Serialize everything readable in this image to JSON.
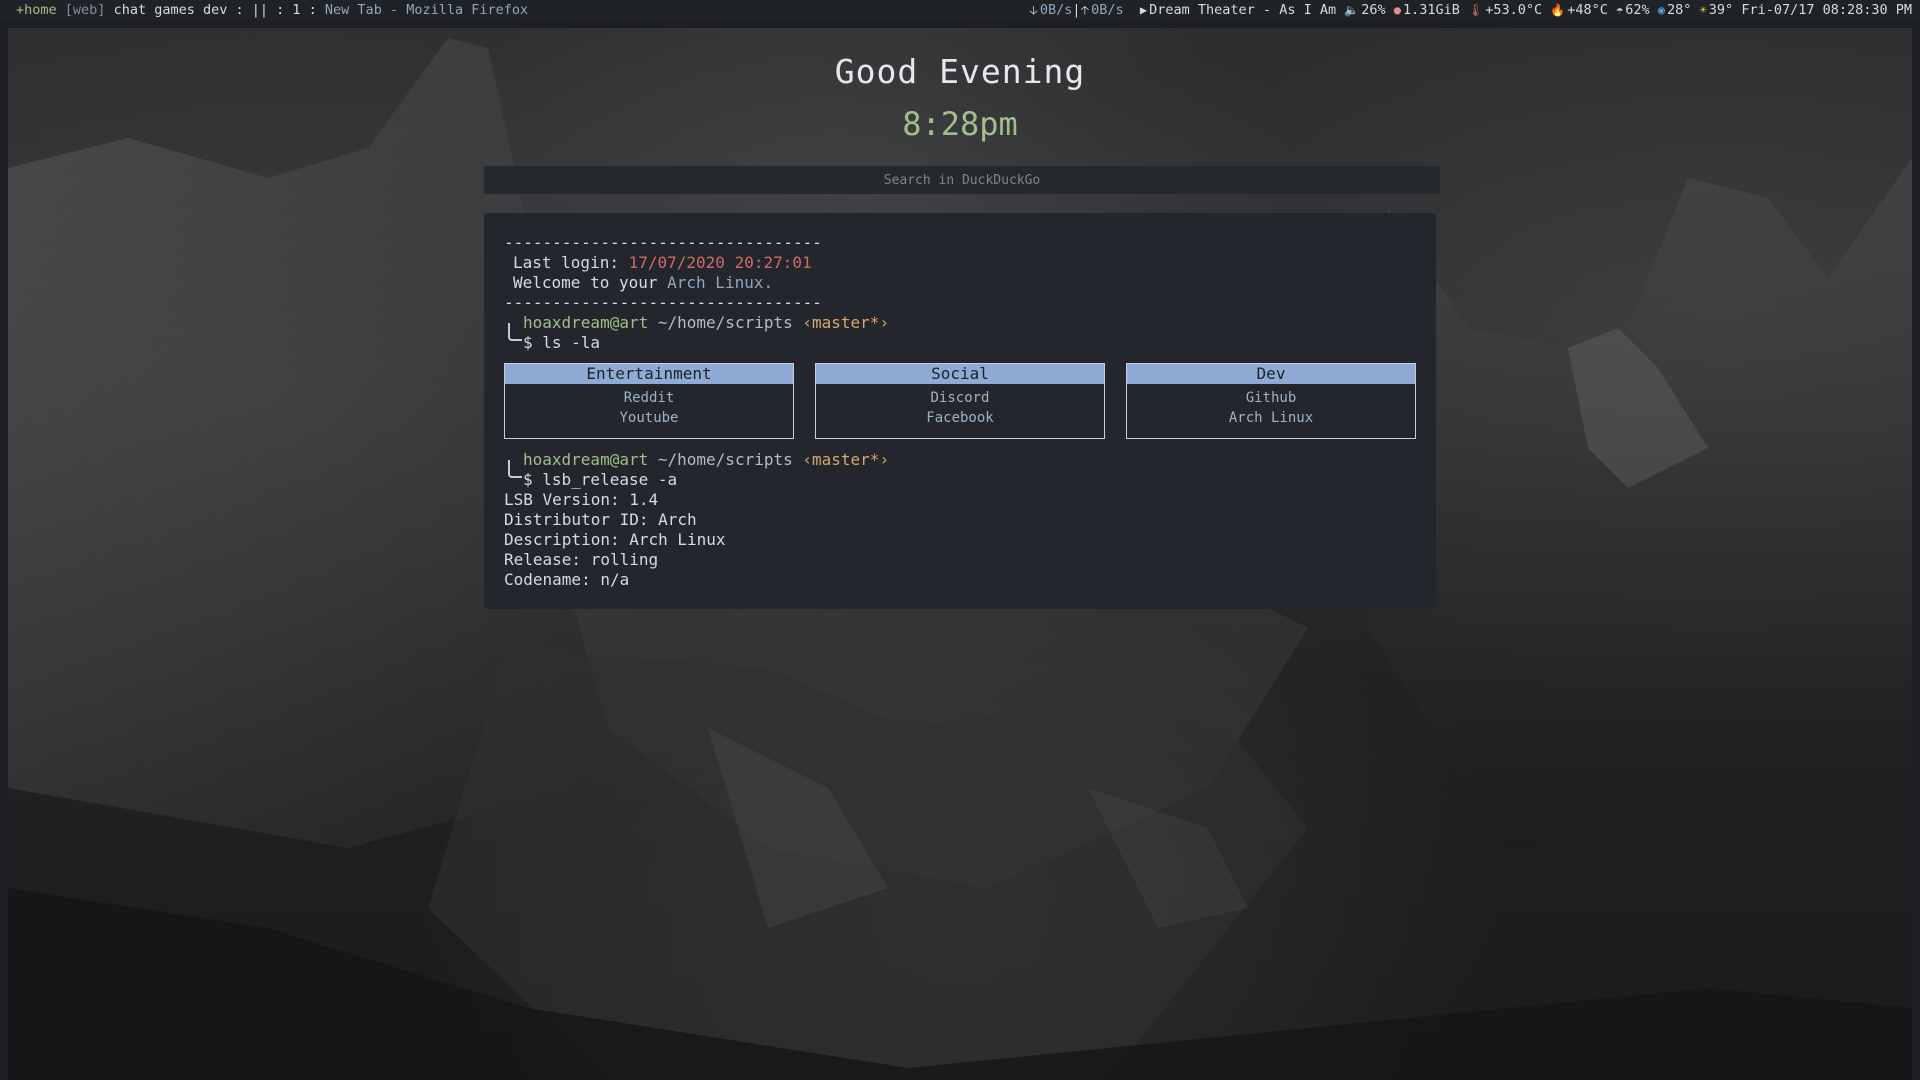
{
  "topbar": {
    "workspaces": {
      "active": "+home",
      "current": "[web]",
      "others": "chat games dev",
      "separator": ": || : 1 :"
    },
    "window_title": "New Tab - Mozilla Firefox",
    "net_down": "0B/s",
    "net_up": "0B/s",
    "now_playing": "Dream Theater - As I Am",
    "volume": "26%",
    "memory": "1.31GiB",
    "cpu_temp": "+53.0°C",
    "gpu_temp": "+48°C",
    "humidity": "62%",
    "weather_temp_a": "28°",
    "weather_temp_b": "39°",
    "datetime": "Fri-07/17 08:28:30 PM",
    "icons": {
      "down": "arrow-down-icon",
      "up": "arrow-up-icon",
      "play": "play-icon",
      "volume": "speaker-icon",
      "memory": "brain-icon",
      "temp": "thermometer-icon",
      "gpu": "fire-icon",
      "humidity": "cloud-rain-icon",
      "weather": "globe-icon",
      "sun": "sun-icon"
    }
  },
  "startpage": {
    "greeting": "Good Evening",
    "clock": "8:28pm",
    "search_placeholder": "Search in DuckDuckGo"
  },
  "terminal": {
    "dashes": "---------------------------------",
    "last_login_label": "Last login:",
    "last_login_value": "17/07/2020 20:27:01",
    "welcome_prefix": "Welcome to your",
    "welcome_os": "Arch Linux.",
    "prompt_user": "hoaxdream@art",
    "prompt_path": "~/home/scripts",
    "prompt_branch": "‹master*›",
    "cmd1": "$ ls -la",
    "cmd2": "$ lsb_release -a",
    "categories": [
      {
        "title": "Entertainment",
        "links": [
          "Reddit",
          "Youtube"
        ]
      },
      {
        "title": "Social",
        "links": [
          "Discord",
          "Facebook"
        ]
      },
      {
        "title": "Dev",
        "links": [
          "Github",
          "Arch Linux"
        ]
      }
    ],
    "output": [
      "LSB Version: 1.4",
      "Distributor ID: Arch",
      "Description: Arch Linux",
      "Release: rolling",
      "Codename: n/a"
    ]
  }
}
